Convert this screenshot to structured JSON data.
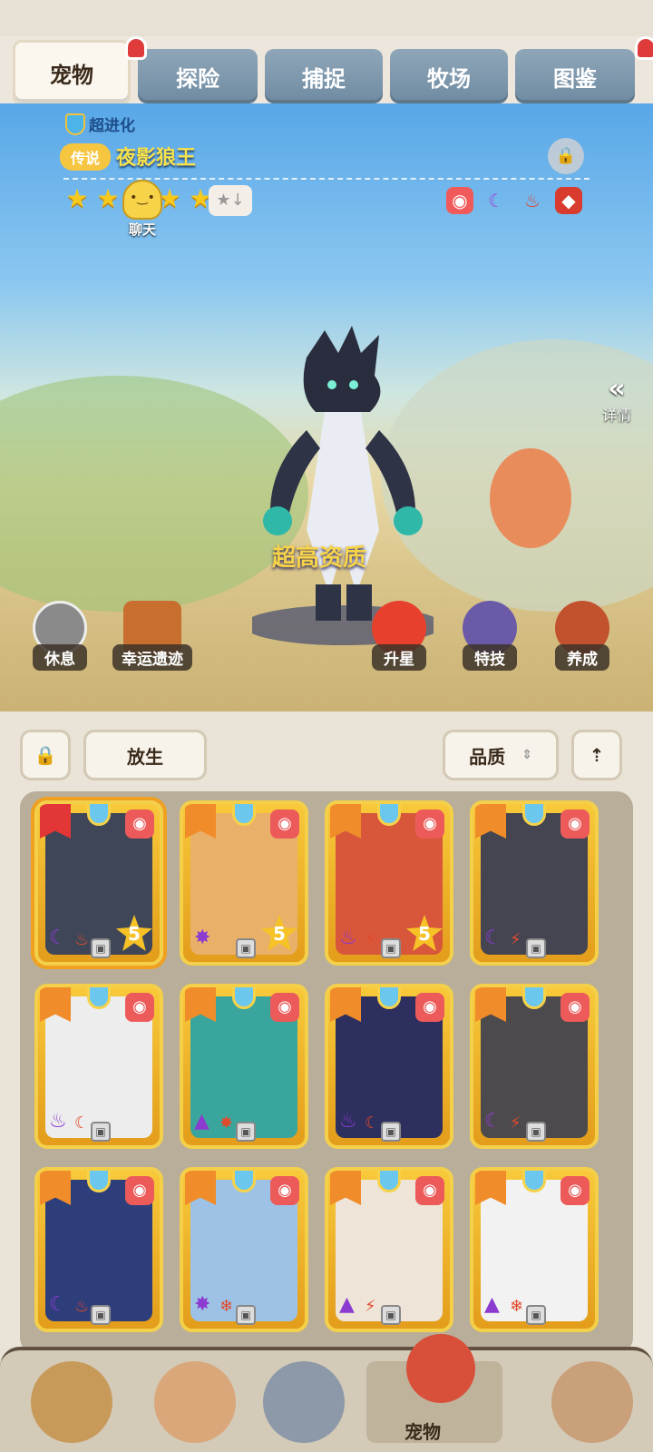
{
  "tabs": [
    {
      "label": "宠物",
      "active": true
    },
    {
      "label": "探险"
    },
    {
      "label": "捕捉"
    },
    {
      "label": "牧场"
    },
    {
      "label": "图鉴"
    }
  ],
  "pet": {
    "evolution": "超进化",
    "rarity": "传说",
    "name": "夜影狼王",
    "quality": "超高资质",
    "star_count": 5
  },
  "chat_label": "聊天",
  "detail_label": "详情",
  "actions": {
    "rest": "休息",
    "ruins": "幸运遗迹",
    "upgrade": "升星",
    "skill": "特技",
    "train": "养成"
  },
  "panel": {
    "release": "放生",
    "sort": "品质"
  },
  "cards": [
    {
      "level": "5",
      "selected": true
    },
    {
      "level": "5"
    },
    {
      "level": "5"
    },
    {
      "level": ""
    },
    {
      "level": ""
    },
    {
      "level": ""
    },
    {
      "level": ""
    },
    {
      "level": ""
    },
    {
      "level": ""
    },
    {
      "level": ""
    },
    {
      "level": ""
    },
    {
      "level": ""
    }
  ],
  "bottom_nav": {
    "active_label": "宠物"
  },
  "colors": {
    "card_gold": "#f4d04a",
    "tab_blue": "#7f97ab",
    "quality_text": "#f7d34a"
  }
}
